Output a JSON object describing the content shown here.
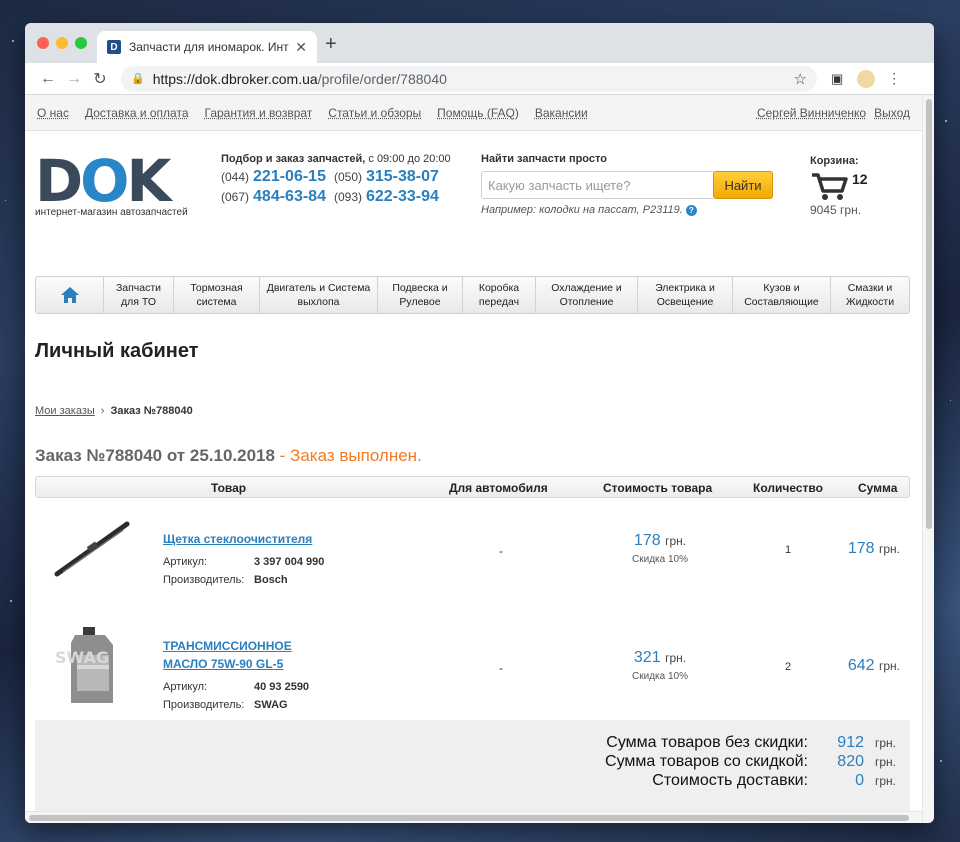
{
  "browser": {
    "tab_title": "Запчасти для иномарок. Инте",
    "url_host": "https://dok.dbroker.com.ua",
    "url_path": "/profile/order/788040"
  },
  "topnav": {
    "links": [
      "О нас",
      "Доставка и оплата",
      "Гарантия и возврат",
      "Статьи и обзоры",
      "Помощь (FAQ)",
      "Вакансии"
    ],
    "user": "Сергей Винниченко",
    "logout": "Выход"
  },
  "header": {
    "logo_text_d": "D",
    "logo_text_o": "O",
    "logo_text_k": "K",
    "logo_sub": "интернет-магазин автозапчастей",
    "phones_title": "Подбор и заказ запчастей,",
    "phones_hours": " с 09:00 до 20:00",
    "phones": [
      {
        "code": "(044)",
        "num": "221-06-15"
      },
      {
        "code": "(050)",
        "num": "315-38-07"
      },
      {
        "code": "(067)",
        "num": "484-63-84"
      },
      {
        "code": "(093)",
        "num": "622-33-94"
      }
    ],
    "search_label": "Найти запчасти просто",
    "search_placeholder": "Какую запчасть ищете?",
    "search_button": "Найти",
    "search_hint": "Например: колодки на пассат, P23119.",
    "cart_label": "Корзина:",
    "cart_count": "12",
    "cart_total": "9045 грн."
  },
  "categories": [
    "Запчасти для ТО",
    "Тормозная система",
    "Двигатель и Система выхлопа",
    "Подвеска и Рулевое",
    "Коробка передач",
    "Охлаждение и Отопление",
    "Электрика и Освещение",
    "Кузов и Составляющие",
    "Смазки и Жидкости"
  ],
  "page_title": "Личный кабинет",
  "breadcrumb": {
    "parent": "Мои заказы",
    "sep": "›",
    "current": "Заказ №788040"
  },
  "order": {
    "title": "Заказ №788040 от 25.10.2018",
    "status": " - Заказ выполнен.",
    "columns": {
      "product": "Товар",
      "car": "Для автомобиля",
      "price": "Стоимость товара",
      "qty": "Количество",
      "sum": "Сумма"
    },
    "items": [
      {
        "name_line1": "Щетка стеклоочистителя",
        "name_line2": "",
        "article_label": "Артикул:",
        "article": "3 397 004 990",
        "maker_label": "Производитель:",
        "maker": "Bosch",
        "car": "-",
        "price": "178",
        "price_cur": "грн.",
        "discount": "Скидка 10%",
        "qty": "1",
        "sum": "178",
        "sum_cur": "грн."
      },
      {
        "name_line1": "ТРАНСМИССИОННОЕ",
        "name_line2": "МАСЛО 75W-90 GL-5",
        "article_label": "Артикул:",
        "article": "40 93 2590",
        "maker_label": "Производитель:",
        "maker": "SWAG",
        "car": "-",
        "price": "321",
        "price_cur": "грн.",
        "discount": "Скидка 10%",
        "qty": "2",
        "sum": "642",
        "sum_cur": "грн."
      }
    ],
    "totals": [
      {
        "label": "Сумма товаров без скидки:",
        "value": "912",
        "cur": "грн."
      },
      {
        "label": "Сумма товаров со скидкой:",
        "value": "820",
        "cur": "грн."
      },
      {
        "label": "Стоимость доставки:",
        "value": "0",
        "cur": "грн."
      }
    ]
  },
  "colors": {
    "accent_blue": "#2a7fbd",
    "status_orange": "#f47a20",
    "button_yellow": "#f5a800"
  }
}
